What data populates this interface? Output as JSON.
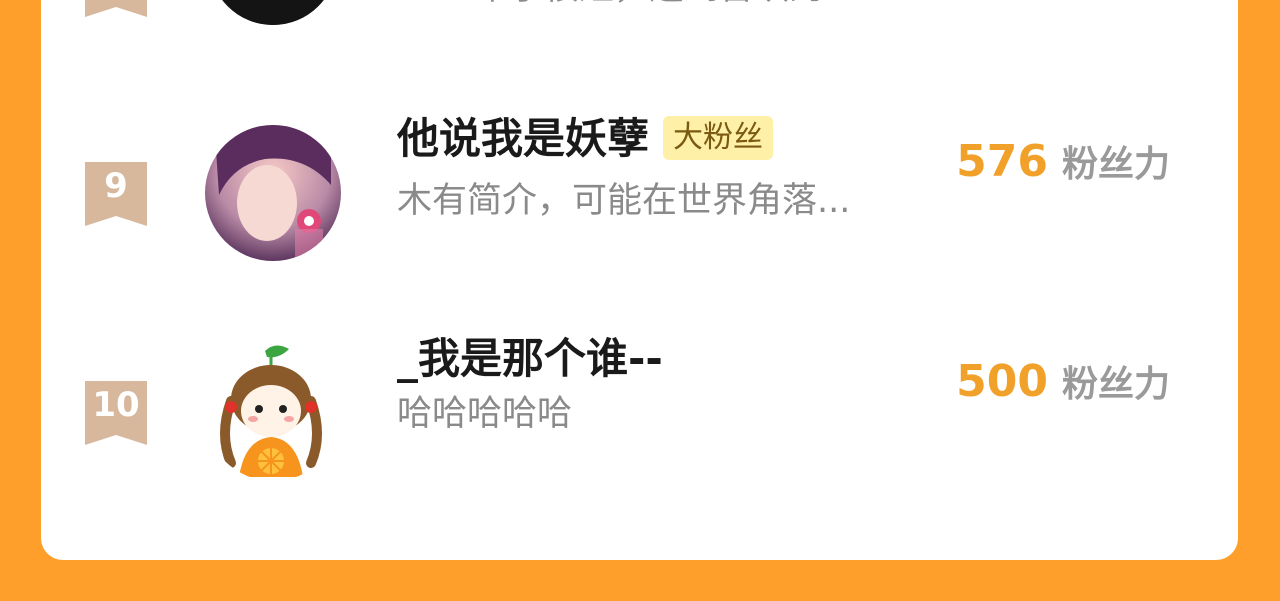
{
  "colors": {
    "page_background": "#FF9F2B",
    "card_background": "#FFFFFF",
    "rank_ribbon": "#D7B89D",
    "number_accent": "#F1A12A",
    "badge_background": "#FFF0A8"
  },
  "rows": [
    {
      "rank": "",
      "name": "",
      "badge": "",
      "bio": "一辈子很短，遇到喜欢的...",
      "power_value": "",
      "power_unit": "",
      "avatar_icon": "avatar-dark-hair-photo"
    },
    {
      "rank": "9",
      "name": "他说我是妖孽",
      "badge": "大粉丝",
      "bio": "木有简介，可能在世界角落...",
      "power_value": "576",
      "power_unit": "粉丝力",
      "avatar_icon": "avatar-girl-photo"
    },
    {
      "rank": "10",
      "name": "_我是那个谁--",
      "badge": "",
      "bio": "哈哈哈哈哈",
      "power_value": "500",
      "power_unit": "粉丝力",
      "avatar_icon": "avatar-cartoon-orange-girl"
    }
  ]
}
